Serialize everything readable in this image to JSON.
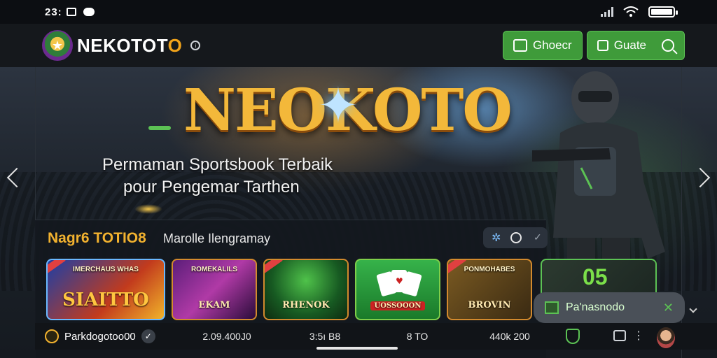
{
  "status_bar": {
    "time": "23:",
    "battery_level": 1.0
  },
  "header": {
    "brand_main": "NEKOTOT",
    "brand_accent": "O",
    "buttons": [
      {
        "label": "Ghoecr",
        "icon": "image-upload-icon"
      },
      {
        "label": "Guate",
        "icon": "square-icon"
      }
    ]
  },
  "hero": {
    "title": "NEOKOTO",
    "line1": "Permaman Sportsbook Terbaik",
    "line2": "pour Pengemar Tarthen"
  },
  "games": {
    "section_title": "Nagr6 TOTIO8",
    "section_sub": "Marolle Ilengramay",
    "cards": [
      {
        "top": "IMERCHAUS WHAS",
        "label": "SIAITTO"
      },
      {
        "top": "ROMEKALILS",
        "label": "EKAM"
      },
      {
        "top": "",
        "label": "RHENOK"
      },
      {
        "top": "",
        "label": "UOSSOOON"
      },
      {
        "top": "PONMOHABES",
        "label": "BROVIN"
      }
    ],
    "promo_number": "05"
  },
  "stats": {
    "user": "Parkdogotoo00",
    "values": [
      "2.09.400J0",
      "3:5ı B8",
      "8 TO",
      "440k 200"
    ]
  },
  "toast": {
    "label": "Pa'nasnodo"
  },
  "colors": {
    "accent_green": "#3f9b3a",
    "accent_gold": "#f2b22f"
  }
}
